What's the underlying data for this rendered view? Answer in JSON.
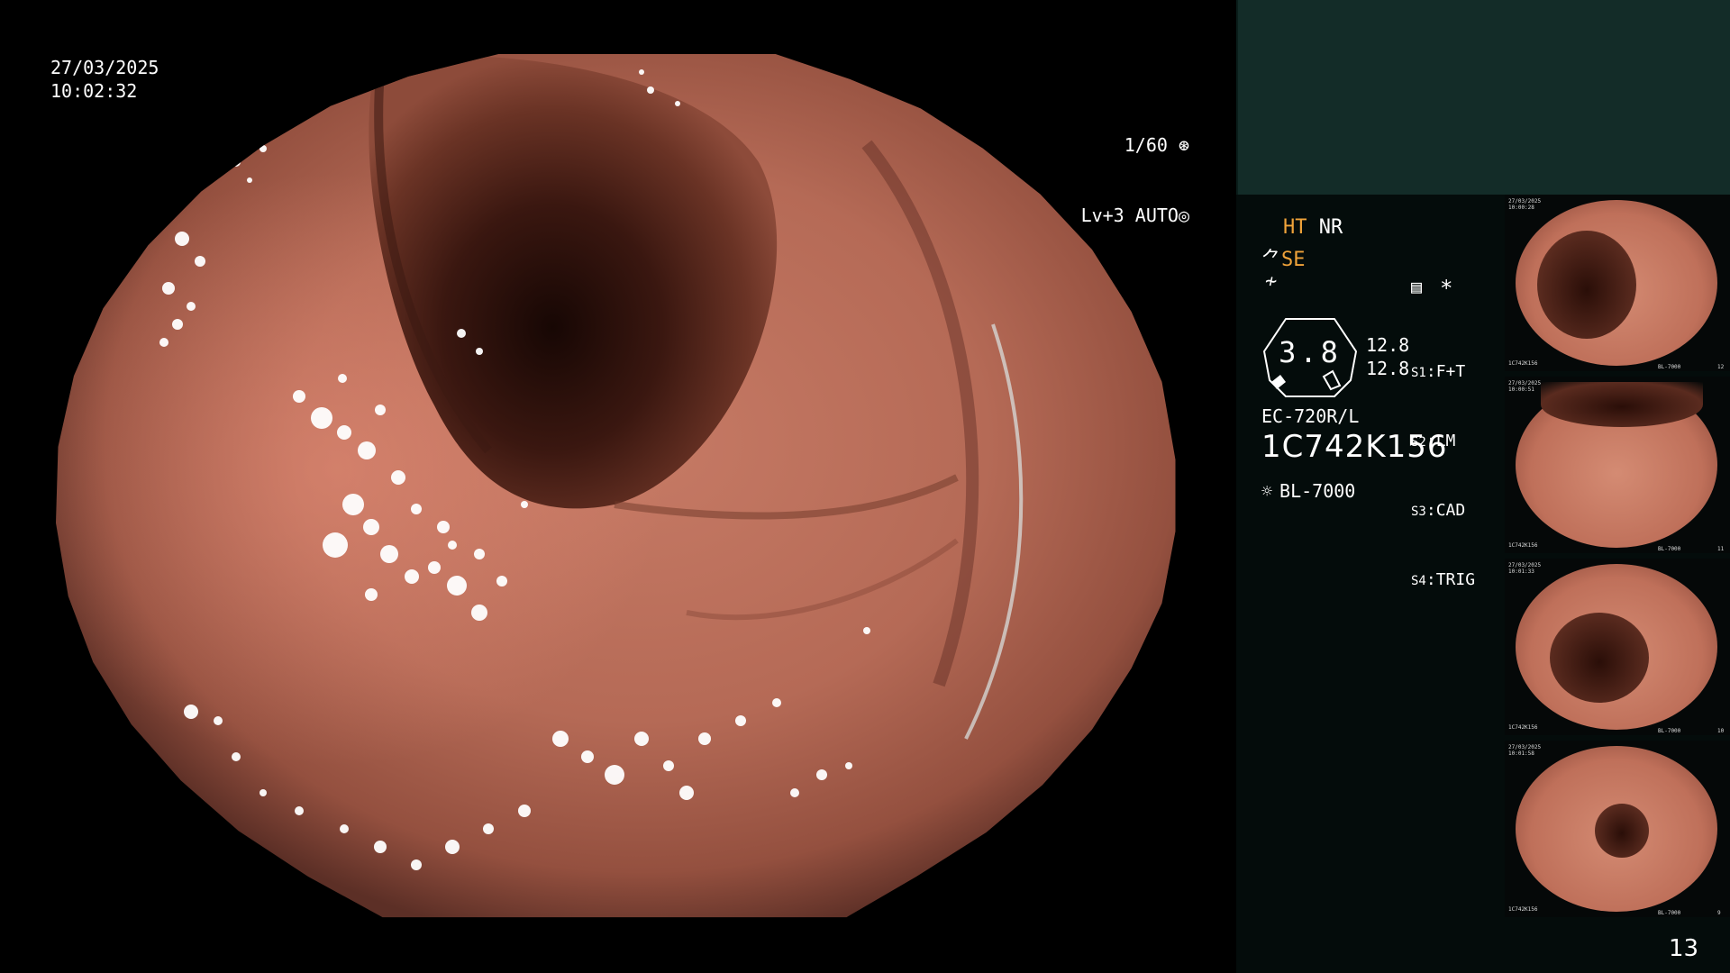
{
  "overlay": {
    "date": "27/03/2025",
    "time": "10:02:32",
    "shutter": "1/60",
    "iris_level": "Lv+3",
    "iris_mode": "AUTO"
  },
  "settings": {
    "ht": "HT",
    "nr": "NR",
    "se": "SE",
    "scope_switches": [
      {
        "key": "S1",
        "value": "F+T"
      },
      {
        "key": "S2",
        "value": "LM"
      },
      {
        "key": "S3",
        "value": "CAD"
      },
      {
        "key": "S4",
        "value": "TRIG"
      }
    ],
    "gauge_value": "3.8",
    "gauge_side_1": "12.8",
    "gauge_side_2": "12.8",
    "star": "*",
    "scope_model": "EC-720R/L",
    "serial": "1C742K156",
    "light_source": "BL-7000"
  },
  "thumbnails": [
    {
      "date": "27/03/2025",
      "time": "10:00:28",
      "serial": "1C742K156",
      "light": "BL-7000",
      "index": "12"
    },
    {
      "date": "27/03/2025",
      "time": "10:00:51",
      "serial": "1C742K156",
      "light": "BL-7000",
      "index": "11"
    },
    {
      "date": "27/03/2025",
      "time": "10:01:33",
      "serial": "1C742K156",
      "light": "BL-7000",
      "index": "10"
    },
    {
      "date": "27/03/2025",
      "time": "10:01:58",
      "serial": "1C742K156",
      "light": "BL-7000",
      "index": "9"
    }
  ],
  "page_number": "13",
  "colors": {
    "accent": "#f0a33a",
    "panel_top": "#132c28",
    "panel": "#040c0b",
    "mucosa": "#c67a65"
  }
}
